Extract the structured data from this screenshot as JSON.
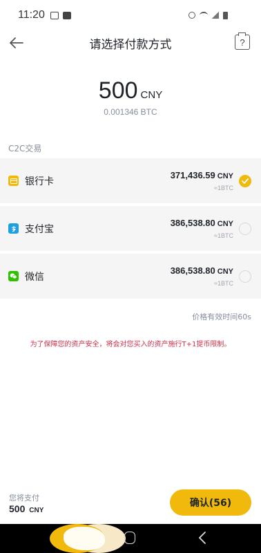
{
  "status_bar": {
    "time": "11:20"
  },
  "header": {
    "title": "请选择付款方式",
    "help_label": "?"
  },
  "amount": {
    "value": "500",
    "unit": "CNY",
    "btc": "0.001346 BTC"
  },
  "section_label": "C2C交易",
  "methods": [
    {
      "name": "银行卡",
      "price": "371,436.59",
      "unit": "CNY",
      "approx": "≈1BTC",
      "icon": "bank-card-icon",
      "icon_color": "#f0b90b",
      "selected": true
    },
    {
      "name": "支付宝",
      "price": "386,538.80",
      "unit": "CNY",
      "approx": "≈1BTC",
      "icon": "alipay-icon",
      "icon_color": "#1e9fe0",
      "selected": false
    },
    {
      "name": "微信",
      "price": "386,538.80",
      "unit": "CNY",
      "approx": "≈1BTC",
      "icon": "wechat-icon",
      "icon_color": "#2dc100",
      "selected": false
    }
  ],
  "validity": "价格有效时间60s",
  "notice": "为了保障您的资产安全，将会对您买入的资产施行T+1提币限制。",
  "pay_bar": {
    "label": "您将支付",
    "amount": "500",
    "unit": "CNY",
    "confirm_label": "确认(56)"
  },
  "colors": {
    "accent": "#f0b90b",
    "notice": "#cf304a",
    "muted": "#848e9c"
  }
}
